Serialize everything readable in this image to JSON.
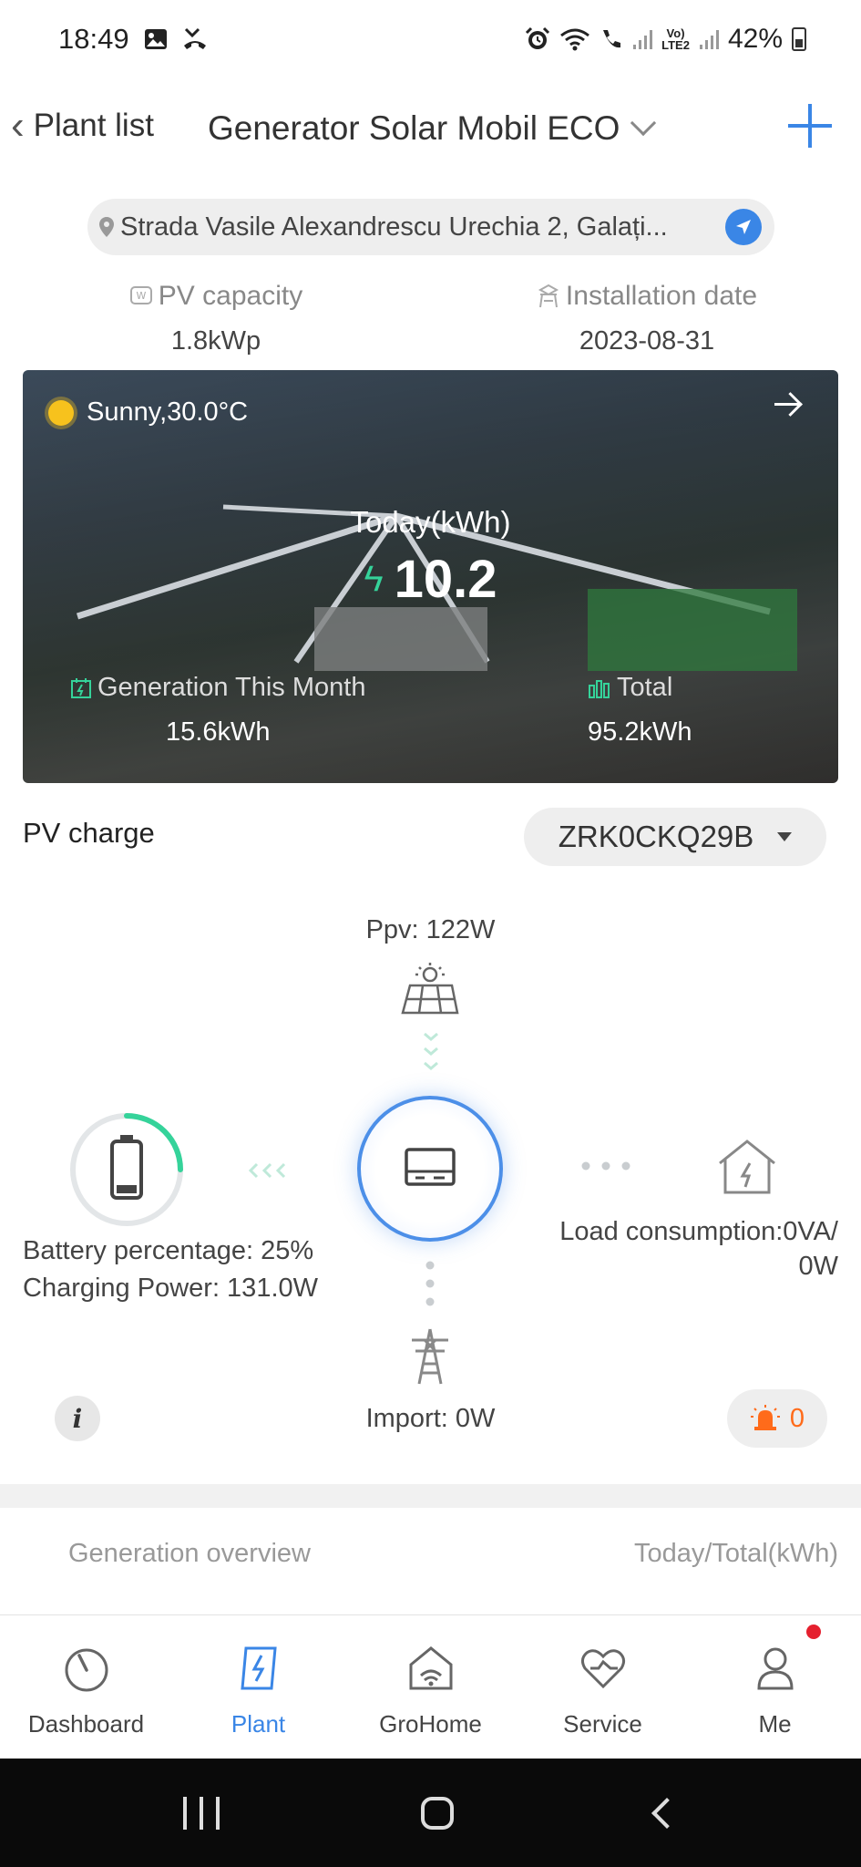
{
  "status_bar": {
    "time": "18:49",
    "battery_pct": "42%",
    "network_tag_top": "Vo)",
    "network_tag_bottom": "LTE2",
    "icons": [
      "image-icon",
      "missed-call-icon",
      "alarm-icon",
      "wifi-icon",
      "wifi-call-icon",
      "signal-icon",
      "battery-icon"
    ]
  },
  "header": {
    "back_label": "Plant list",
    "plant_name": "Generator Solar Mobil ECO",
    "add_icon": "plus-icon"
  },
  "address": {
    "text": "Strada Vasile Alexandrescu Urechia 2, Galați...",
    "icon": "location-pin-icon",
    "nav_icon": "navigation-icon"
  },
  "plant_info": {
    "pv_capacity_label": "PV capacity",
    "pv_capacity_value": "1.8kWp",
    "install_date_label": "Installation date",
    "install_date_value": "2023-08-31"
  },
  "banner": {
    "weather": "Sunny,30.0°C",
    "today_label": "Today(kWh)",
    "today_value": "10.2",
    "month_label": "Generation This Month",
    "month_value": "15.6kWh",
    "total_label": "Total",
    "total_value": "95.2kWh",
    "accent": "#35d39a"
  },
  "pv_charge": {
    "label": "PV charge",
    "device": "ZRK0CKQ29B"
  },
  "flow": {
    "ppv": "Ppv: 122W",
    "battery_line1": "Battery percentage: 25%",
    "battery_line2": "Charging Power: 131.0W",
    "battery_level": 0.25,
    "load_line1": "Load consumption:0VA/",
    "load_line2": "0W",
    "import": "Import: 0W",
    "alarm_count": "0",
    "info_icon": "info-icon"
  },
  "overview": {
    "title": "Generation overview",
    "unit": "Today/Total(kWh)"
  },
  "tabs": [
    {
      "label": "Dashboard",
      "icon": "dashboard-icon"
    },
    {
      "label": "Plant",
      "icon": "plant-icon"
    },
    {
      "label": "GroHome",
      "icon": "grohome-icon"
    },
    {
      "label": "Service",
      "icon": "service-icon"
    },
    {
      "label": "Me",
      "icon": "me-icon"
    }
  ],
  "colors": {
    "primary": "#3a86e6",
    "alarm": "#ff6b1a",
    "notification": "#e5202e"
  }
}
